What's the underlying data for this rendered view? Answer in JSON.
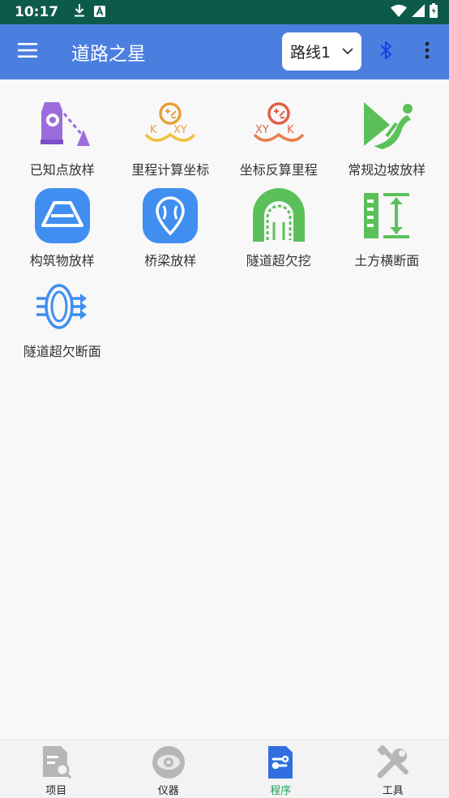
{
  "status_bar": {
    "time": "10:17",
    "left_icons": [
      "download-icon",
      "a-badge-icon"
    ],
    "right_icons": [
      "wifi-icon",
      "signal-icon",
      "battery-icon"
    ]
  },
  "app_bar": {
    "title": "道路之星",
    "route_select": {
      "selected": "路线1"
    },
    "icons": [
      "menu-icon",
      "bluetooth-icon",
      "more-vert-icon"
    ]
  },
  "programs": [
    {
      "label": "已知点放样",
      "icon": "known-point-stakeout-icon"
    },
    {
      "label": "里程计算坐标",
      "icon": "mileage-to-coordinate-icon"
    },
    {
      "label": "坐标反算里程",
      "icon": "coordinate-to-mileage-icon"
    },
    {
      "label": "常规边坡放样",
      "icon": "slope-stakeout-icon"
    },
    {
      "label": "构筑物放样",
      "icon": "structure-stakeout-icon"
    },
    {
      "label": "桥梁放样",
      "icon": "bridge-stakeout-icon"
    },
    {
      "label": "隧道超欠挖",
      "icon": "tunnel-overbreak-icon"
    },
    {
      "label": "土方横断面",
      "icon": "earthwork-section-icon"
    },
    {
      "label": "隧道超欠断面",
      "icon": "tunnel-section-icon"
    }
  ],
  "bottom_nav": {
    "items": [
      {
        "label": "项目",
        "icon": "project-icon"
      },
      {
        "label": "仪器",
        "icon": "instrument-icon"
      },
      {
        "label": "程序",
        "icon": "program-icon"
      },
      {
        "label": "工具",
        "icon": "tools-icon"
      }
    ],
    "active_index": 2
  },
  "colors": {
    "status_bar": "#0d5a4a",
    "app_bar": "#4a7fe0",
    "active_nav": "#1aa35a",
    "background": "#f8f8f8"
  }
}
